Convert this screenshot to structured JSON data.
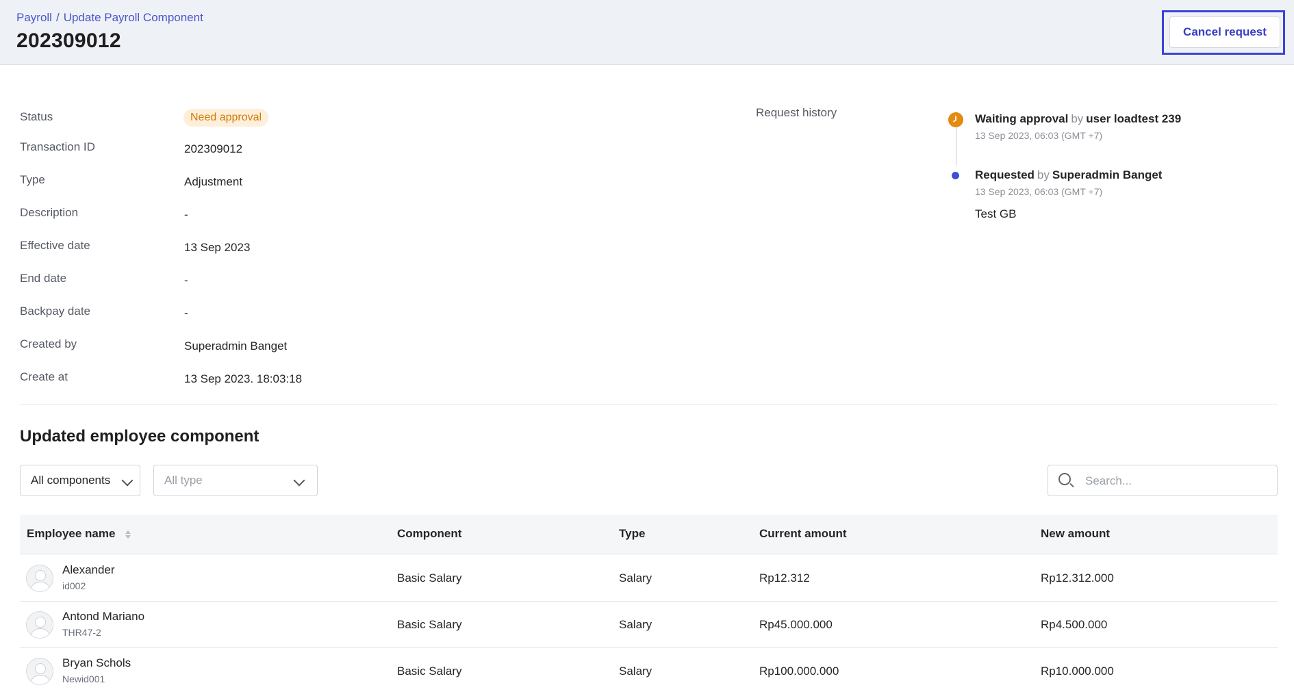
{
  "header": {
    "breadcrumb": [
      "Payroll",
      "Update Payroll Component"
    ],
    "breadcrumb_separator": "/",
    "title": "202309012",
    "cancel_label": "Cancel request"
  },
  "details": {
    "status": {
      "label": "Status",
      "value": "Need approval"
    },
    "transaction_id": {
      "label": "Transaction ID",
      "value": "202309012"
    },
    "type": {
      "label": "Type",
      "value": "Adjustment"
    },
    "description": {
      "label": "Description",
      "value": "-"
    },
    "effective_date": {
      "label": "Effective date",
      "value": "13 Sep 2023"
    },
    "end_date": {
      "label": "End date",
      "value": "-"
    },
    "backpay_date": {
      "label": "Backpay date",
      "value": "-"
    },
    "created_by": {
      "label": "Created by",
      "value": "Superadmin Banget"
    },
    "create_at": {
      "label": "Create at",
      "value": "13 Sep 2023. 18:03:18"
    }
  },
  "history": {
    "label": "Request history",
    "events": [
      {
        "action": "Waiting approval",
        "by": "by",
        "user": "user loadtest 239",
        "time": "13 Sep 2023, 06:03 (GMT +7)",
        "icon": "clock-icon",
        "color": "#e38a10"
      },
      {
        "action": "Requested",
        "by": "by",
        "user": "Superadmin Banget",
        "time": "13 Sep 2023, 06:03 (GMT +7)",
        "note": "Test GB",
        "icon": "dot-icon",
        "color": "#3b4fd8"
      }
    ]
  },
  "section": {
    "title": "Updated employee component"
  },
  "filters": {
    "components": "All components",
    "type": "All type",
    "search_placeholder": "Search..."
  },
  "table": {
    "columns": [
      "Employee name",
      "Component",
      "Type",
      "Current amount",
      "New amount"
    ],
    "rows": [
      {
        "name": "Alexander",
        "id": "id002",
        "component": "Basic Salary",
        "type": "Salary",
        "current": "Rp12.312",
        "new": "Rp12.312.000"
      },
      {
        "name": "Antond Mariano",
        "id": "THR47-2",
        "component": "Basic Salary",
        "type": "Salary",
        "current": "Rp45.000.000",
        "new": "Rp4.500.000"
      },
      {
        "name": "Bryan Schols",
        "id": "Newid001",
        "component": "Basic Salary",
        "type": "Salary",
        "current": "Rp100.000.000",
        "new": "Rp10.000.000"
      }
    ]
  },
  "colors": {
    "accent": "#3b42d6",
    "status_warning": "#d17a08",
    "status_warning_bg": "#fdefd9"
  }
}
